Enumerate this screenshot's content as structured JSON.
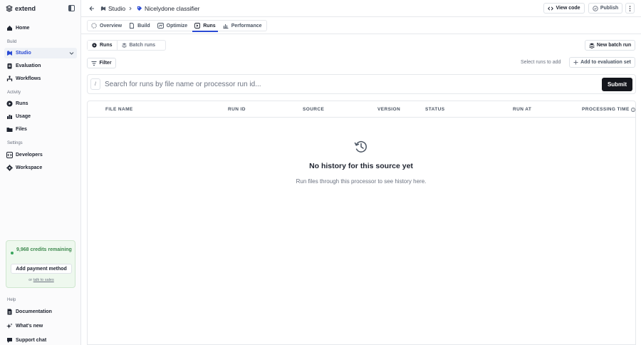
{
  "brand": {
    "name": "extend"
  },
  "sidebar": {
    "home": "Home",
    "build_label": "Build",
    "build_items": [
      "Studio",
      "Evaluation",
      "Workflows"
    ],
    "activity_label": "Activity",
    "activity_items": [
      "Runs",
      "Usage",
      "Files"
    ],
    "settings_label": "Settings",
    "settings_items": [
      "Developers",
      "Workspace"
    ],
    "help_label": "Help",
    "help_items": [
      "Documentation",
      "What's new",
      "Support chat"
    ],
    "credits": {
      "text": "9,968 credits remaining",
      "button": "Add payment method",
      "talk_prefix": "or",
      "talk_link": "talk to sales"
    }
  },
  "header": {
    "breadcrumb": [
      "Studio",
      "Nicelydone classifier"
    ],
    "view_code": "View code",
    "publish": "Publish"
  },
  "tabs": [
    "Overview",
    "Build",
    "Optimize",
    "Runs",
    "Performance"
  ],
  "runs_toggle": [
    "Runs",
    "Batch runs"
  ],
  "new_batch_run": "New batch run",
  "filter": "Filter",
  "select_runs_hint": "Select runs to add",
  "add_to_eval": "Add to evaluation set",
  "search": {
    "shortcut": "/",
    "placeholder": "Search for runs by file name or processor run id...",
    "submit": "Submit"
  },
  "table": {
    "columns": [
      "FILE NAME",
      "RUN ID",
      "SOURCE",
      "VERSION",
      "STATUS",
      "RUN AT",
      "PROCESSING TIME"
    ]
  },
  "empty": {
    "title": "No history for this source yet",
    "subtitle": "Run files through this processor to see history here."
  },
  "colors": {
    "accent": "#2b4bd4",
    "credits_green": "#3f8a4f",
    "submit_bg": "#14161c"
  }
}
